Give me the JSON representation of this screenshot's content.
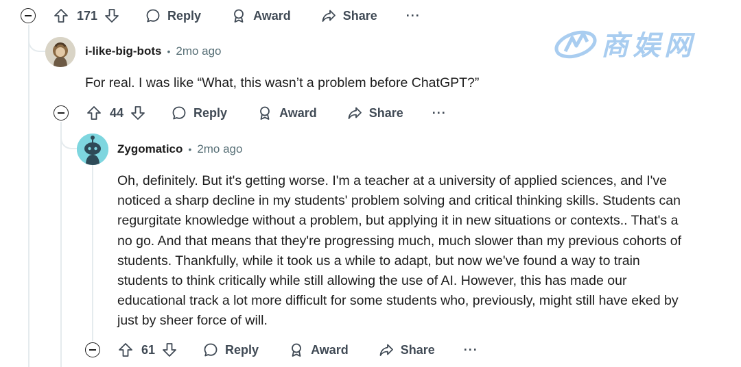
{
  "watermark": {
    "text": "商娱网"
  },
  "actions_top": {
    "votes": "171",
    "reply": "Reply",
    "award": "Award",
    "share": "Share",
    "more": "···"
  },
  "comment1": {
    "username": "i-like-big-bots",
    "separator": "•",
    "time": "2mo ago",
    "body": "For real. I was like “What, this wasn’t a problem before ChatGPT?”",
    "actions": {
      "votes": "44",
      "reply": "Reply",
      "award": "Award",
      "share": "Share",
      "more": "···"
    }
  },
  "comment2": {
    "username": "Zygomatico",
    "separator": "•",
    "time": "2mo ago",
    "body_lines": [
      "Oh, definitely. But it's getting worse. I'm a teacher at a university of applied sciences, and I've",
      "noticed a sharp decline in my students' problem solving and critical thinking skills. Students can",
      "regurgitate knowledge without a problem, but applying it in new situations or contexts.. That's a",
      "no go. And that means that they're progressing much, much slower than my previous cohorts of",
      "students. Thankfully, while it took us a while to adapt, but now we've found a way to train",
      "students to think critically while still allowing the use of AI. However, this has made our",
      "educational track a lot more difficult for some students who, previously, might still have eked by",
      "just by sheer force of will."
    ],
    "actions": {
      "votes": "61",
      "reply": "Reply",
      "award": "Award",
      "share": "Share",
      "more": "···"
    }
  },
  "colors": {
    "text": "#1c1c1c",
    "meta": "#576f76",
    "action": "#404a55",
    "thread": "#e5ebee",
    "avatar_bg": "#7ed6df",
    "watermark": "#a9cdf0"
  }
}
